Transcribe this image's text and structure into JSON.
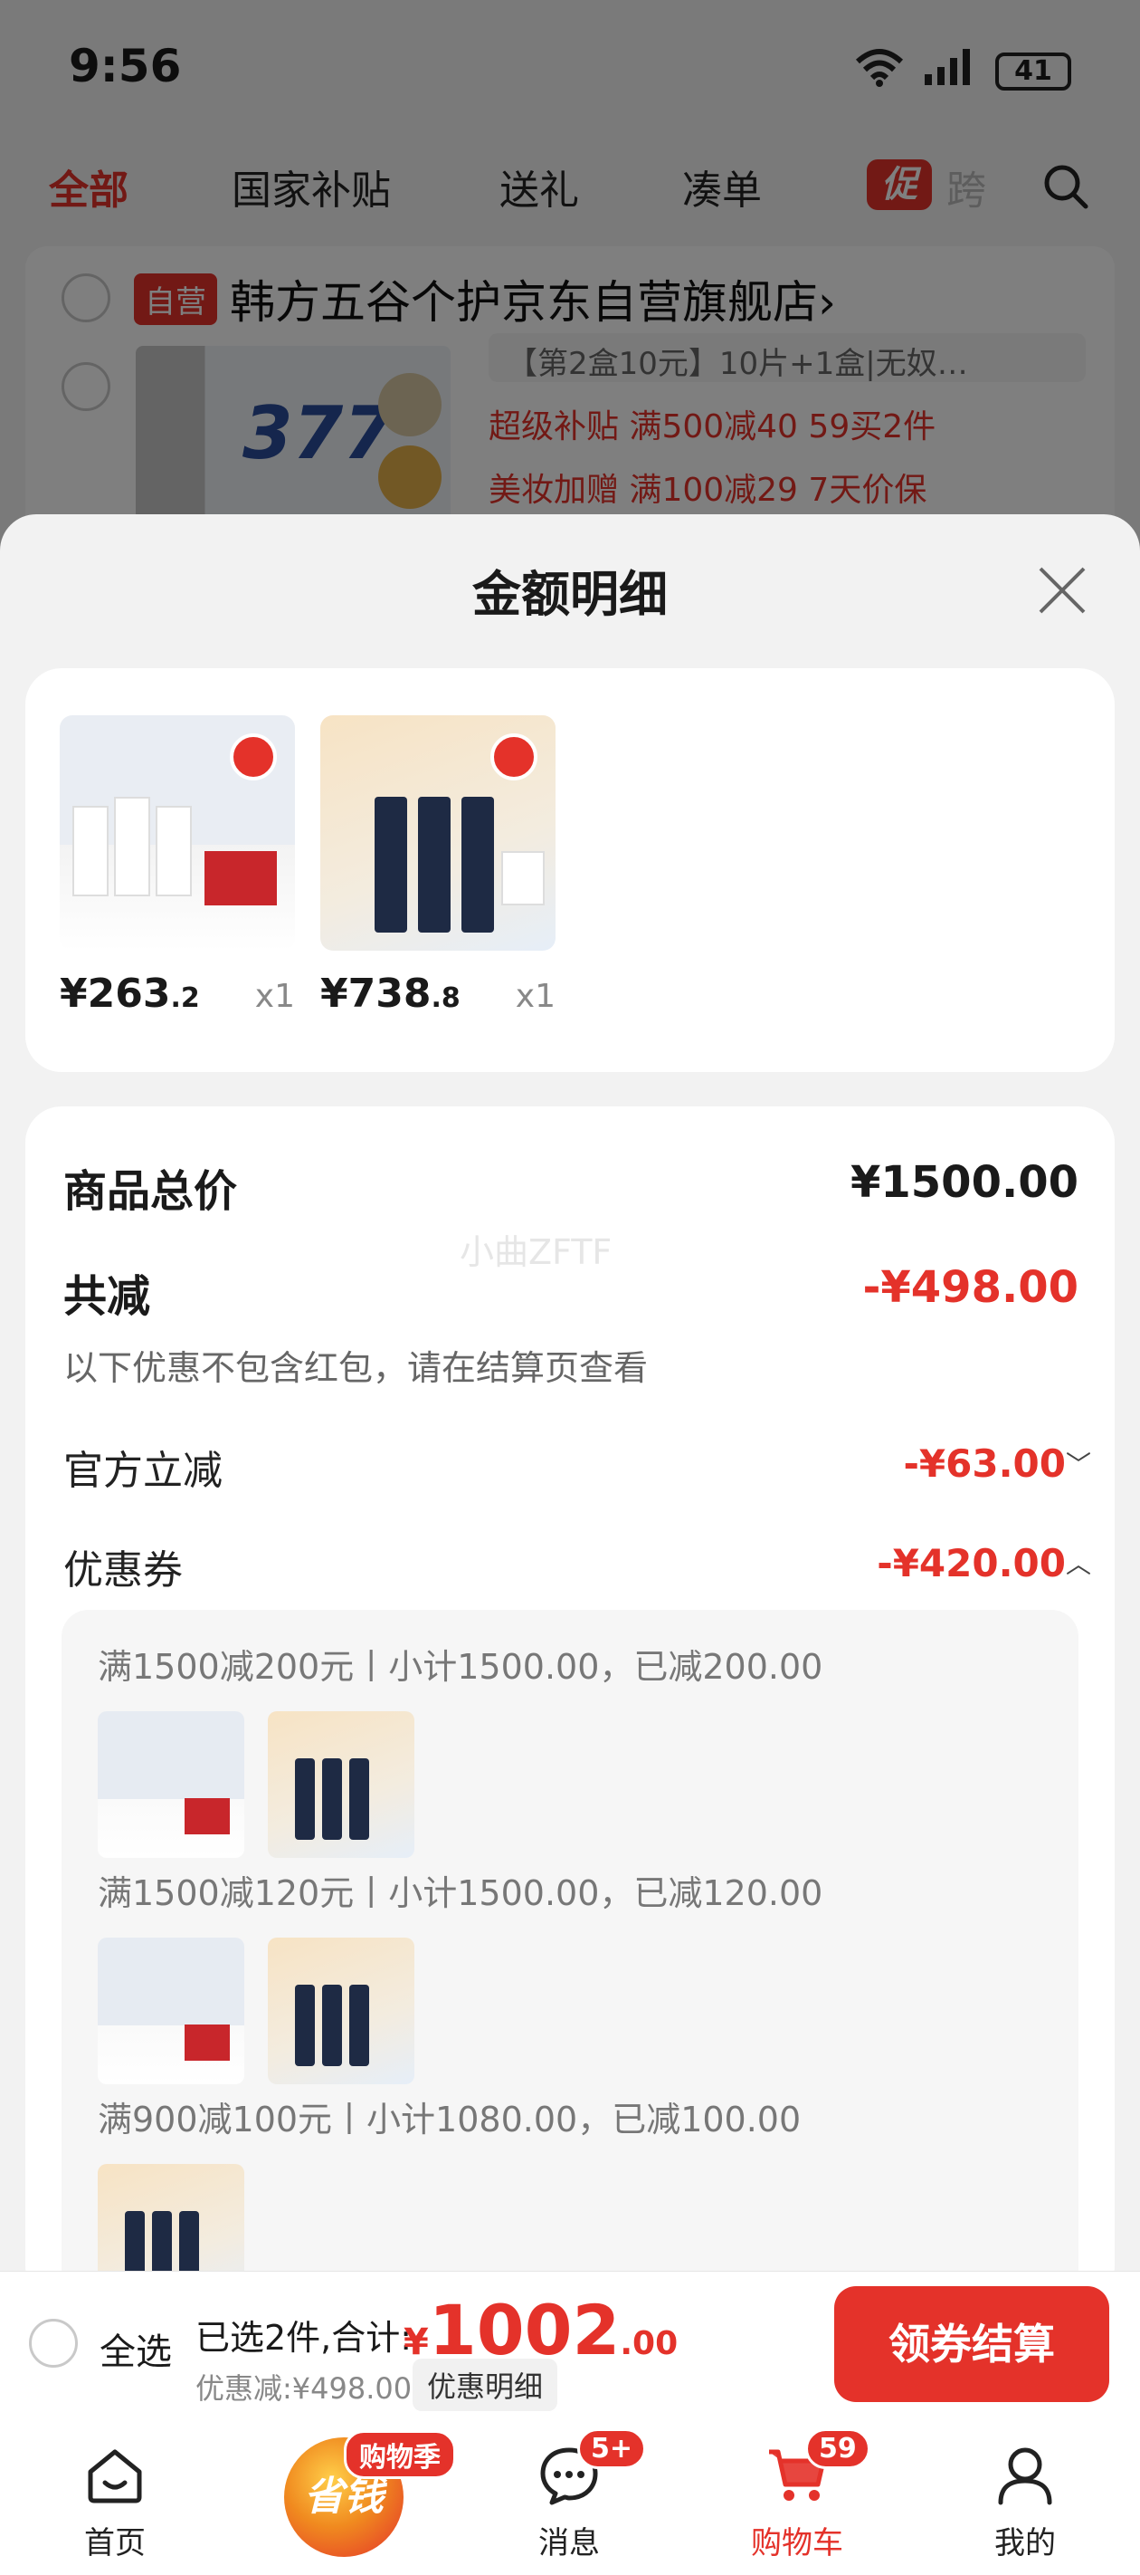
{
  "status": {
    "time": "9:56",
    "battery": "41"
  },
  "tabs": [
    "全部",
    "国家补贴",
    "送礼",
    "凑单"
  ],
  "tabs_promo": "促",
  "tabs_faded": "跨",
  "store": {
    "tag": "自营",
    "name": "韩方五谷个护京东自营旗舰店",
    "chevron": "›"
  },
  "cart_item": {
    "thumb_text": "377",
    "spec": "【第2盒10元】10片+1盒|无奴…",
    "promo1": "超级补贴 满500减40  59买2件",
    "promo2": "美妆加赠  满100减29  7天价保"
  },
  "sheet": {
    "title": "金额明细",
    "products": [
      {
        "price_int": "¥263",
        "price_dec": ".2",
        "qty": "x1"
      },
      {
        "price_int": "¥738",
        "price_dec": ".8",
        "qty": "x1"
      }
    ],
    "total_label": "商品总价",
    "total_value": "¥1500.00",
    "watermark": "小曲ZFTF",
    "reduce_label": "共减",
    "reduce_value": "-¥498.00",
    "reduce_note": "以下优惠不包含红包，请在结算页查看",
    "official_label": "官方立减",
    "official_value": "-¥63.00",
    "coupon_label": "优惠券",
    "coupon_value": "-¥420.00",
    "coupons": [
      "满1500减200元丨小计1500.00，已减200.00",
      "满1500减120元丨小计1500.00，已减120.00",
      "满900减100元丨小计1080.00，已减100.00"
    ]
  },
  "checkout": {
    "select_all": "全选",
    "selected_info": "已选2件,合计:",
    "total_currency": "¥",
    "total_int": "1002",
    "total_dec": ".00",
    "discount_note": "优惠减:¥498.00",
    "detail_button": "优惠明细",
    "pay_button": "领券结算"
  },
  "nav": {
    "home": "首页",
    "save": "省钱",
    "season_badge": "购物季",
    "messages": "消息",
    "messages_badge": "5+",
    "cart": "购物车",
    "cart_badge": "59",
    "me": "我的"
  },
  "colors": {
    "accent": "#e4322a"
  }
}
